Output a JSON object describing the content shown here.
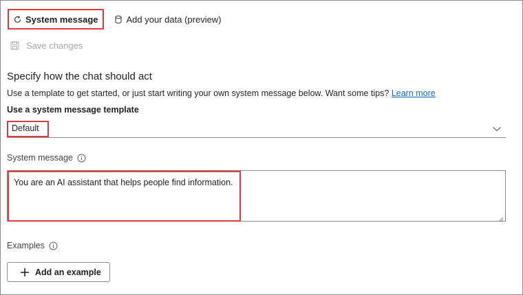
{
  "tabs": {
    "system_message": "System message",
    "add_data": "Add your data (preview)"
  },
  "toolbar": {
    "save_label": "Save changes"
  },
  "setup": {
    "heading": "Specify how the chat should act",
    "description": "Use a template to get started, or just start writing your own system message below. Want some tips?",
    "learn_more": "Learn more",
    "template_label": "Use a system message template",
    "template_value": "Default",
    "system_message_label": "System message",
    "system_message_value": "You are an AI assistant that helps people find information.",
    "examples_label": "Examples",
    "add_example_label": "Add an example"
  },
  "icons": {
    "system_message": "refresh-icon",
    "add_data": "database-icon",
    "save": "save-icon",
    "dropdown": "chevron-down-icon",
    "info": "info-icon",
    "add": "plus-icon"
  },
  "colors": {
    "highlight": "#e03a3a",
    "link": "#0f6cbd",
    "disabled": "#a6a6a6"
  }
}
